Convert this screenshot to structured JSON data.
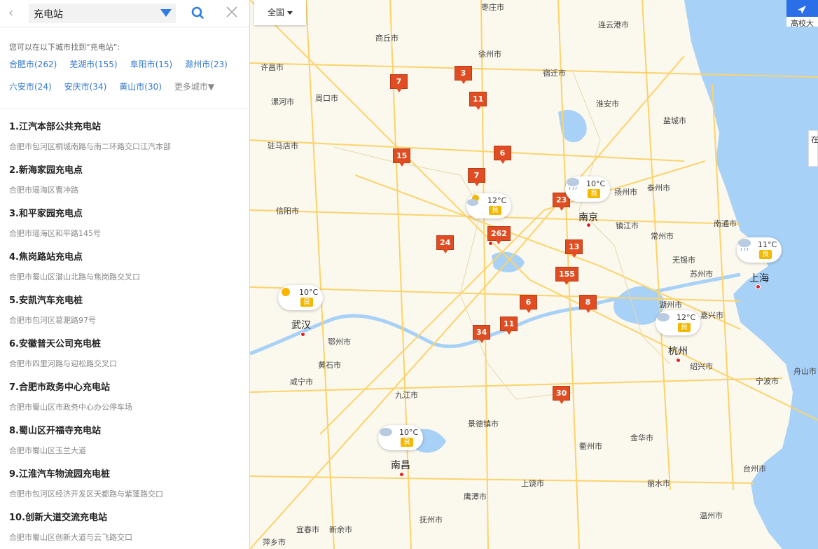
{
  "search": {
    "query": "充电站"
  },
  "hint": "您可以在以下城市找到“充电站”:",
  "cities": [
    "合肥市(262)",
    "芜湖市(155)",
    "阜阳市(15)",
    "滁州市(23)",
    "六安市(24)",
    "安庆市(34)",
    "黄山市(30)"
  ],
  "more_cities": "更多城市▼",
  "results": [
    {
      "name": "1.江汽本部公共充电站",
      "addr": "合肥市包河区桐城南路与南二环路交口江汽本部"
    },
    {
      "name": "2.新海家园充电点",
      "addr": "合肥市瑶海区曹冲路"
    },
    {
      "name": "3.和平家园充电点",
      "addr": "合肥市瑶海区和平路145号"
    },
    {
      "name": "4.焦岗路站充电点",
      "addr": "合肥市蜀山区潜山北路与焦岗路交叉口"
    },
    {
      "name": "5.安凯汽车充电桩",
      "addr": "合肥市包河区葛淝路97号"
    },
    {
      "name": "6.安徽普天公司充电桩",
      "addr": "合肥市四里河路与迎松路交叉口"
    },
    {
      "name": "7.合肥市政务中心充电站",
      "addr": "合肥市蜀山区市政务中心办公停车场"
    },
    {
      "name": "8.蜀山区开福寺充电站",
      "addr": "合肥市蜀山区玉兰大道"
    },
    {
      "name": "9.江淮汽车物流园充电桩",
      "addr": "合肥市包河区经济开发区天都路与紫蓬路交口"
    },
    {
      "name": "10.创新大道交流充电站",
      "addr": "合肥市蜀山区创新大道与云飞路交口"
    }
  ],
  "map": {
    "region_button": "全国",
    "corner_label": "高校大",
    "side_tab": "在",
    "markers": [
      "3",
      "7",
      "11",
      "15",
      "6",
      "7",
      "23",
      "262",
      "24",
      "13",
      "155",
      "6",
      "8",
      "11",
      "34",
      "30"
    ],
    "weather": [
      {
        "temp": "12°C",
        "aqi": "良",
        "icon": "partly-cloudy"
      },
      {
        "temp": "10°C",
        "aqi": "良",
        "icon": "cloud-rain"
      },
      {
        "temp": "11°C",
        "aqi": "良",
        "icon": "cloud-rain"
      },
      {
        "temp": "10°C",
        "aqi": "良",
        "icon": "sun"
      },
      {
        "temp": "12°C",
        "aqi": "良",
        "icon": "cloud"
      },
      {
        "temp": "10°C",
        "aqi": "良",
        "icon": "cloud"
      }
    ],
    "city_labels": {
      "zaozhuang": "枣庄市",
      "lianyungang": "连云港市",
      "shangqiu": "商丘市",
      "xuzhou": "徐州市",
      "xuchang": "许昌市",
      "suqian": "宿迁市",
      "luohe": "漯河市",
      "zhoukou": "周口市",
      "huaian": "淮安市",
      "yancheng": "盐城市",
      "zhumadian": "驻马店市",
      "yangzhou": "扬州市",
      "taizhou_js": "泰州市",
      "xinyang": "信阳市",
      "nanjing": "南京",
      "zhenjiang": "镇江市",
      "changzhou": "常州市",
      "nantong": "南通市",
      "wuxi": "无锡市",
      "suzhou": "苏州市",
      "shanghai": "上海",
      "wuhan": "武汉",
      "ezhou": "鄂州市",
      "huzhou": "湖州市",
      "jiaxing": "嘉兴市",
      "huangshi": "黄石市",
      "hangzhou": "杭州",
      "shaoxing": "绍兴市",
      "xianning": "咸宁市",
      "ningbo": "宁波市",
      "zhoushan": "舟山市",
      "jiujiang": "九江市",
      "jingdezhen": "景德镇市",
      "jinhua": "金华市",
      "quzhou": "衢州市",
      "nanchang": "南昌",
      "shangrao": "上饶市",
      "taizhou_zj": "台州市",
      "lishui": "丽水市",
      "yingtan": "鹰潭市",
      "wenzhou": "温州市",
      "yichun": "宜春市",
      "xinyu": "新余市",
      "fuzhou": "抚州市",
      "pingxiang": "萍乡市"
    }
  }
}
